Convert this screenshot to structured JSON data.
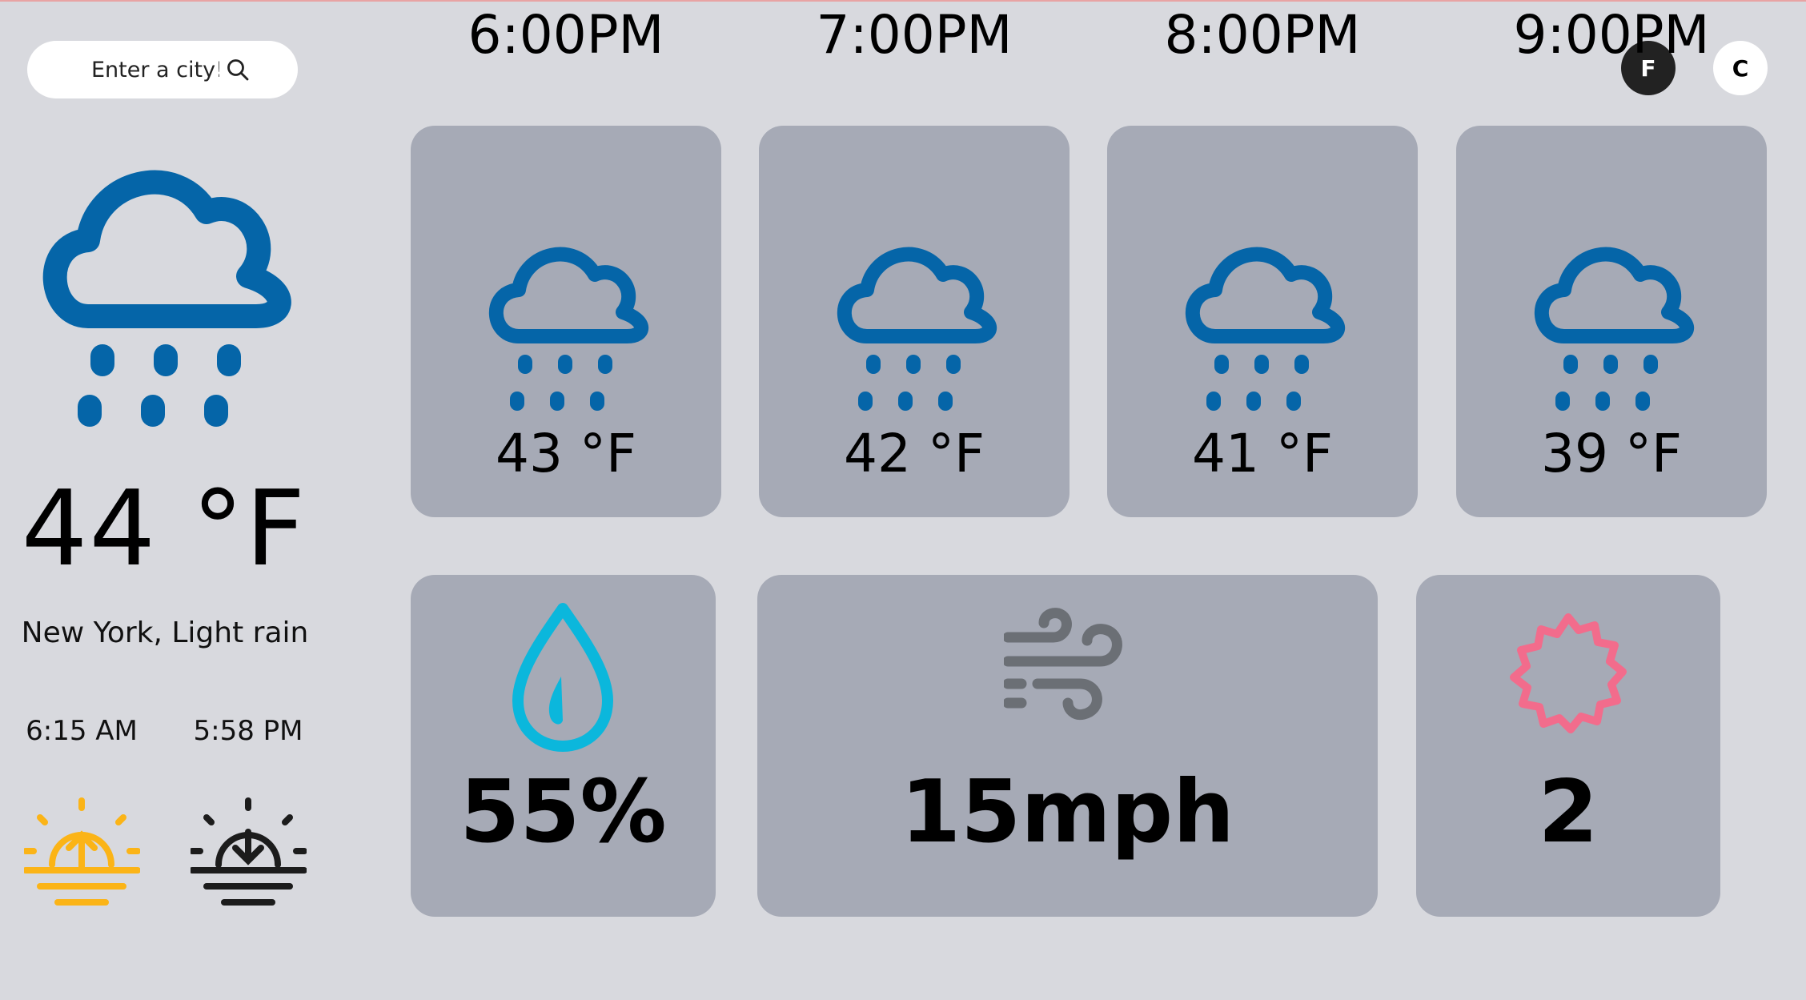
{
  "search": {
    "placeholder": "Enter a city!"
  },
  "units": {
    "f_label": "F",
    "c_label": "C",
    "selected": "F"
  },
  "current": {
    "temperature": "44 °F",
    "location_condition": "New York, Light rain",
    "sunrise": "6:15 AM",
    "sunset": "5:58 PM",
    "icon": "cloud-rain-icon"
  },
  "hourly": [
    {
      "time": "6:00PM",
      "temp": "43 °F",
      "icon": "cloud-rain-icon"
    },
    {
      "time": "7:00PM",
      "temp": "42 °F",
      "icon": "cloud-rain-icon"
    },
    {
      "time": "8:00PM",
      "temp": "41 °F",
      "icon": "cloud-rain-icon"
    },
    {
      "time": "9:00PM",
      "temp": "39 °F",
      "icon": "cloud-rain-icon"
    }
  ],
  "stats": {
    "humidity": {
      "value": "55%",
      "icon": "droplet-icon"
    },
    "wind": {
      "value": "15mph",
      "icon": "wind-icon"
    },
    "uv": {
      "value": "2",
      "icon": "sun-badge-icon"
    }
  },
  "colors": {
    "background": "#d8d9de",
    "card": "#a6aab6",
    "rain_blue": "#0565a8",
    "droplet_cyan": "#0bb7dc",
    "wind_gray": "#6b6f75",
    "uv_pink": "#f26c8c",
    "sunrise_yellow": "#fbb417",
    "sunset_dark": "#1c1c1c"
  }
}
